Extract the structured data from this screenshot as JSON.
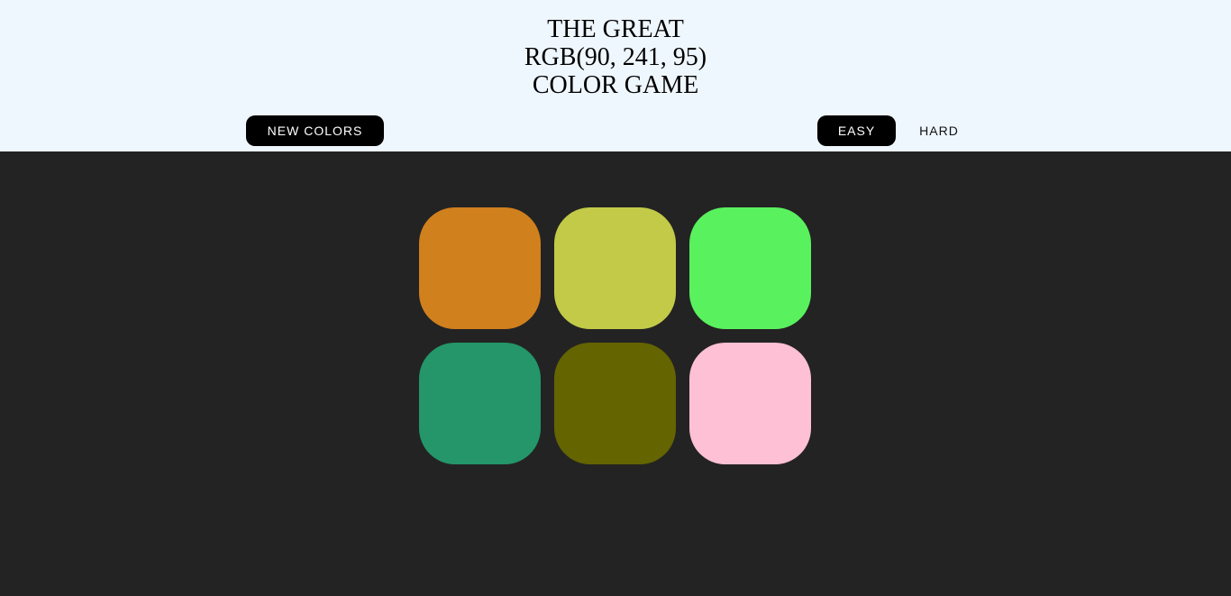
{
  "header": {
    "title_line1": "THE GREAT",
    "target_color": "RGB(90, 241, 95)",
    "title_line3": "COLOR GAME"
  },
  "controls": {
    "new_colors_label": "NEW COLORS",
    "easy_label": "EASY",
    "hard_label": "HARD",
    "selected_mode": "EASY"
  },
  "colors": {
    "header_bg": "#eff7fe",
    "board_bg": "#232323",
    "button_active_bg": "#000000"
  },
  "squares": [
    {
      "color": "rgb(209, 128, 30)"
    },
    {
      "color": "rgb(194, 202, 72)"
    },
    {
      "color": "rgb(90, 241, 95)"
    },
    {
      "color": "rgb(36, 150, 105)"
    },
    {
      "color": "rgb(100, 100, 0)"
    },
    {
      "color": "rgb(254, 192, 212)"
    }
  ]
}
